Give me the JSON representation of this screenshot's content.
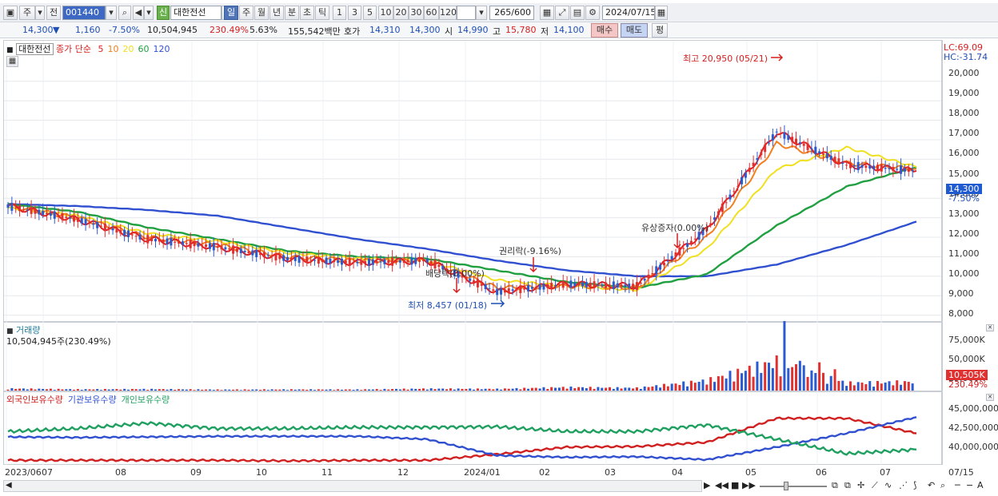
{
  "toolbar": {
    "market_label": "주",
    "type_label": "전",
    "code": "001440",
    "signal_label": "신",
    "name": "대한전선",
    "periods": [
      "일",
      "주",
      "월",
      "년",
      "분",
      "초",
      "틱"
    ],
    "active_period": "일",
    "intervals": [
      "1",
      "3",
      "5",
      "10",
      "20",
      "30",
      "60",
      "120"
    ],
    "count": "265/600",
    "date": "2024/07/15"
  },
  "quote": {
    "price": "14,300",
    "change": "1,160",
    "change_pct": "-7.50%",
    "volume": "10,504,945",
    "volume_ratio": "230.49%",
    "turnover_rate": "5.63%",
    "amount": "155,542백만",
    "ask_label": "호가",
    "ask": "14,310",
    "bid": "14,300",
    "open_label": "시",
    "open": "14,990",
    "high_label": "고",
    "high": "15,780",
    "low_label": "저",
    "low": "14,100",
    "buy_label": "매수",
    "sell_label": "매도",
    "eval_label": "평"
  },
  "price_panel": {
    "stock": "대한전선",
    "ma_prefix": "종가 단순",
    "ma_periods": [
      {
        "label": "5",
        "color": "#e02020"
      },
      {
        "label": "10",
        "color": "#f08020"
      },
      {
        "label": "20",
        "color": "#f0e020"
      },
      {
        "label": "60",
        "color": "#20a040"
      },
      {
        "label": "120",
        "color": "#3050d0"
      }
    ],
    "lc": "LC:69.09",
    "hc": "HC:-31.74",
    "y_ticks": [
      "20,000",
      "19,000",
      "18,000",
      "17,000",
      "16,000",
      "15,000",
      "14,000",
      "13,000",
      "12,000",
      "11,000",
      "10,000",
      "9,000",
      "8,000"
    ],
    "current_tag": "14,300",
    "current_pct": "-7.50%",
    "high_annotation": "최고 20,950 (05/21)",
    "low_annotation": "최저 8,457 (01/18)",
    "events": [
      "권리락(-9.16%)",
      "배당락(0.00%)",
      "유상증자(0.00%)"
    ]
  },
  "volume_panel": {
    "title": "거래량",
    "value": "10,504,945주(230.49%)",
    "y_ticks": [
      "75,000K",
      "50,000K",
      "25,000K"
    ],
    "current_tag": "10,505K",
    "current_pct": "230.49%"
  },
  "holdings_panel": {
    "series": [
      {
        "name": "외국인보유수량",
        "color": "#d02020"
      },
      {
        "name": "기관보유수량",
        "color": "#3050d0"
      },
      {
        "name": "개인보유수량",
        "color": "#20a060"
      }
    ],
    "y_ticks": [
      "45,000,000",
      "42,500,000",
      "40,000,000"
    ]
  },
  "x_axis": [
    "2023/06",
    "07",
    "08",
    "09",
    "10",
    "11",
    "12",
    "2024/01",
    "02",
    "03",
    "04",
    "05",
    "06",
    "07",
    "07/15"
  ],
  "chart_data": [
    {
      "type": "line",
      "title": "대한전선",
      "ylim": [
        7700,
        21300
      ],
      "x": [
        "2023-06",
        "2023-07",
        "2023-08",
        "2023-09",
        "2023-10",
        "2023-11",
        "2023-12",
        "2024-01",
        "2024-02",
        "2024-03",
        "2024-04",
        "2024-05",
        "2024-06",
        "2024-07"
      ],
      "series": [
        {
          "name": "5",
          "values": [
            13600,
            12900,
            11900,
            11500,
            10900,
            10700,
            10800,
            9200,
            9600,
            9500,
            12400,
            17400,
            15700,
            15400
          ]
        },
        {
          "name": "10",
          "values": [
            13600,
            13000,
            12000,
            11600,
            11000,
            10800,
            10800,
            9400,
            9500,
            9400,
            12000,
            16800,
            15800,
            15500
          ]
        },
        {
          "name": "20",
          "values": [
            13500,
            13100,
            12200,
            11800,
            11200,
            10900,
            10800,
            9800,
            9500,
            9300,
            11400,
            15500,
            16600,
            15600
          ]
        },
        {
          "name": "60",
          "values": [
            13700,
            13300,
            12500,
            11900,
            11300,
            11000,
            10900,
            10300,
            9700,
            9400,
            10100,
            12600,
            14600,
            15600
          ]
        },
        {
          "name": "120",
          "values": [
            13700,
            13600,
            13400,
            13100,
            12500,
            11900,
            11400,
            10800,
            10300,
            10000,
            10000,
            10600,
            11600,
            12800
          ]
        }
      ],
      "annotations": [
        {
          "text": "최고 20,950 (05/21)",
          "x": "2024-05-21",
          "y": 20950
        },
        {
          "text": "최저 8,457 (01/18)",
          "x": "2024-01-18",
          "y": 8457
        }
      ]
    },
    {
      "type": "bar",
      "title": "거래량",
      "ylim": [
        0,
        90000
      ],
      "x": [
        "2023-06",
        "2023-07",
        "2023-08",
        "2023-09",
        "2023-10",
        "2023-11",
        "2023-12",
        "2024-01",
        "2024-02",
        "2024-03",
        "2024-04",
        "2024-05",
        "2024-06",
        "2024-07"
      ],
      "series": [
        {
          "name": "거래량",
          "values": [
            2500,
            1500,
            1800,
            1200,
            1400,
            1300,
            2300,
            2000,
            4000,
            3200,
            12000,
            35000,
            9000,
            10505
          ]
        }
      ]
    },
    {
      "type": "line",
      "ylim": [
        37500,
        47500
      ],
      "x": [
        "2023-06",
        "2023-07",
        "2023-08",
        "2023-09",
        "2023-10",
        "2023-11",
        "2023-12",
        "2024-01",
        "2024-02",
        "2024-03",
        "2024-04",
        "2024-05",
        "2024-06",
        "2024-07"
      ],
      "series": [
        {
          "name": "외국인보유수량",
          "values": [
            38000,
            38000,
            38000,
            38000,
            37900,
            38000,
            38000,
            39000,
            40200,
            40300,
            41000,
            45000,
            45000,
            42500
          ]
        },
        {
          "name": "기관보유수량",
          "values": [
            41900,
            41800,
            41900,
            42000,
            42000,
            42000,
            41500,
            38800,
            38500,
            38600,
            38100,
            40200,
            42500,
            45200
          ]
        },
        {
          "name": "개인보유수량",
          "values": [
            42800,
            43300,
            44200,
            43300,
            43300,
            43500,
            43500,
            43600,
            42800,
            42800,
            43900,
            41500,
            39100,
            39800
          ]
        }
      ]
    }
  ]
}
